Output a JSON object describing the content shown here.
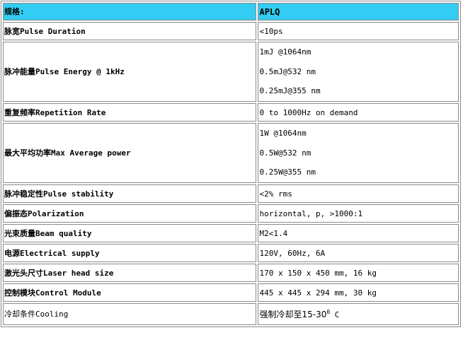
{
  "header": {
    "key": "规格:",
    "value": "APLQ"
  },
  "rows": [
    {
      "key": "脉宽Pulse Duration",
      "value": "<10ps"
    },
    {
      "key": "脉冲能量Pulse Energy @ 1kHz",
      "values": [
        "1mJ @1064nm",
        "0.5mJ@532 nm",
        "0.25mJ@355 nm"
      ]
    },
    {
      "key": "重复频率Repetition Rate",
      "value": "0 to 1000Hz on demand"
    },
    {
      "key": "最大平均功率Max Average power",
      "values": [
        "1W @1064nm",
        "0.5W@532 nm",
        "0.25W@355 nm"
      ]
    },
    {
      "key": "脉冲稳定性Pulse stability",
      "value": "<2% rms"
    },
    {
      "key": "偏振态Polarization",
      "value": "horizontal, p, >1000:1"
    },
    {
      "key": "光束质量Beam quality",
      "value": "M2<1.4"
    },
    {
      "key": "电源Electrical supply",
      "value": "120V, 60Hz, 6A"
    },
    {
      "key": "激光头尺寸Laser head size",
      "value": "170 x 150 x 450 mm, 16 kg"
    },
    {
      "key": "控制模块Control Module",
      "value": "445 x 445 x 294 mm, 30 kg"
    },
    {
      "key": "冷却条件Cooling",
      "value_main": "强制冷却至15-30",
      "value_sup": "0",
      "value_tail": " C"
    }
  ]
}
